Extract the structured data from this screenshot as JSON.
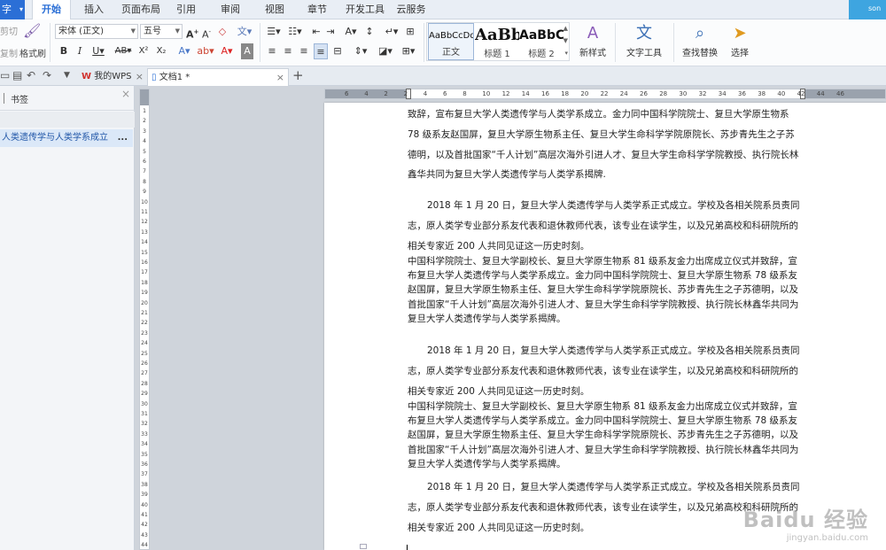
{
  "menu": {
    "app_label": "字",
    "tabs": [
      "开始",
      "插入",
      "页面布局",
      "引用",
      "审阅",
      "视图",
      "章节",
      "开发工具",
      "云服务"
    ],
    "active_tab": "开始",
    "user_label": "son"
  },
  "ribbon": {
    "clipboard": {
      "cut": "剪切",
      "copy": "复制",
      "format_painter": "格式刷"
    },
    "font_name": "宋体 (正文)",
    "font_size": "五号",
    "styles": [
      {
        "sample": "AaBbCcDd",
        "label": "正文"
      },
      {
        "sample": "AaBb",
        "label": "标题 1"
      },
      {
        "sample": "AaBbC",
        "label": "标题 2"
      }
    ],
    "new_style": "新样式",
    "text_tools": "文字工具",
    "find_replace": "查找替换",
    "select": "选择"
  },
  "doc_tabs": {
    "tabs": [
      {
        "label": "我的WPS",
        "active": false
      },
      {
        "label": "文档1 *",
        "active": true
      }
    ],
    "new_tab": "+"
  },
  "nav_pane": {
    "title": "书签",
    "items": [
      {
        "label": "人类遗传学与人类学系成立",
        "more": "..."
      }
    ]
  },
  "rulers": {
    "horizontal": [
      "6",
      "4",
      "2",
      "2",
      "4",
      "6",
      "8",
      "10",
      "12",
      "14",
      "16",
      "18",
      "20",
      "22",
      "24",
      "26",
      "28",
      "30",
      "32",
      "34",
      "36",
      "38",
      "40",
      "42",
      "44",
      "46"
    ],
    "vertical": [
      "1",
      "2",
      "3",
      "4",
      "5",
      "6",
      "7",
      "8",
      "9",
      "10",
      "11",
      "12",
      "13",
      "14",
      "15",
      "16",
      "17",
      "18",
      "19",
      "20",
      "21",
      "22",
      "23",
      "24",
      "25",
      "26",
      "27",
      "28",
      "29",
      "30",
      "31",
      "32",
      "33",
      "34",
      "35",
      "36",
      "37",
      "38",
      "39",
      "40",
      "41",
      "42",
      "43",
      "44"
    ]
  },
  "document": {
    "paragraphs": [
      {
        "style": "loose",
        "indent": false,
        "text": "致辞，宣布复旦大学人类遗传学与人类学系成立。金力同中国科学院院士、复旦大学原生物系 78 级系友赵国屏，复旦大学原生物系主任、复旦大学生命科学学院原院长、苏步青先生之子苏德明，以及首批国家“千人计划”高层次海外引进人才、复旦大学生命科学学院教授、执行院长林鑫华共同为复旦大学人类遗传学与人类学系揭牌."
      },
      {
        "style": "loose",
        "indent": true,
        "text": "2018 年 1 月 20 日，复旦大学人类遗传学与人类学系正式成立。学校及各相关院系员责同志，原人类学专业部分系友代表和退休教师代表，该专业在读学生，以及兄弟高校和科研院所的相关专家近 200 人共同见证这一历史时刻。"
      },
      {
        "style": "tight",
        "indent": false,
        "text": "中国科学院院士、复旦大学副校长、复旦大学原生物系 81 级系友金力出席成立仪式并致辞，宣布复旦大学人类遗传学与人类学系成立。金力同中国科学院院士、复旦大学原生物系 78 级系友赵国屏，复旦大学原生物系主任、复旦大学生命科学学院原院长、苏步青先生之子苏德明，以及首批国家“千人计划”高层次海外引进人才、复旦大学生命科学学院教授、执行院长林鑫华共同为复旦大学人类遗传学与人类学系揭牌。"
      },
      {
        "style": "loose",
        "indent": true,
        "text": "2018 年 1 月 20 日，复旦大学人类遗传学与人类学系正式成立。学校及各相关院系员责同志，原人类学专业部分系友代表和退休教师代表，该专业在读学生，以及兄弟高校和科研院所的相关专家近 200 人共同见证这一历史时刻。"
      },
      {
        "style": "tight",
        "indent": false,
        "text": "中国科学院院士、复旦大学副校长、复旦大学原生物系 81 级系友金力出席成立仪式并致辞，宣布复旦大学人类遗传学与人类学系成立。金力同中国科学院院士、复旦大学原生物系 78 级系友赵国屏，复旦大学原生物系主任、复旦大学生命科学学院原院长、苏步青先生之子苏德明，以及首批国家“千人计划”高层次海外引进人才、复旦大学生命科学学院教授、执行院长林鑫华共同为复旦大学人类遗传学与人类学系揭牌。"
      },
      {
        "style": "loose",
        "indent": true,
        "text": "2018 年 1 月 20 日，复旦大学人类遗传学与人类学系正式成立。学校及各相关院系员责同志，原人类学专业部分系友代表和退休教师代表，该专业在读学生，以及兄弟高校和科研院所的相关专家近 200 人共同见证这一历史时刻。"
      }
    ]
  },
  "watermark": {
    "line1": "Baidu 经验",
    "line2": "jingyan.baidu.com"
  }
}
